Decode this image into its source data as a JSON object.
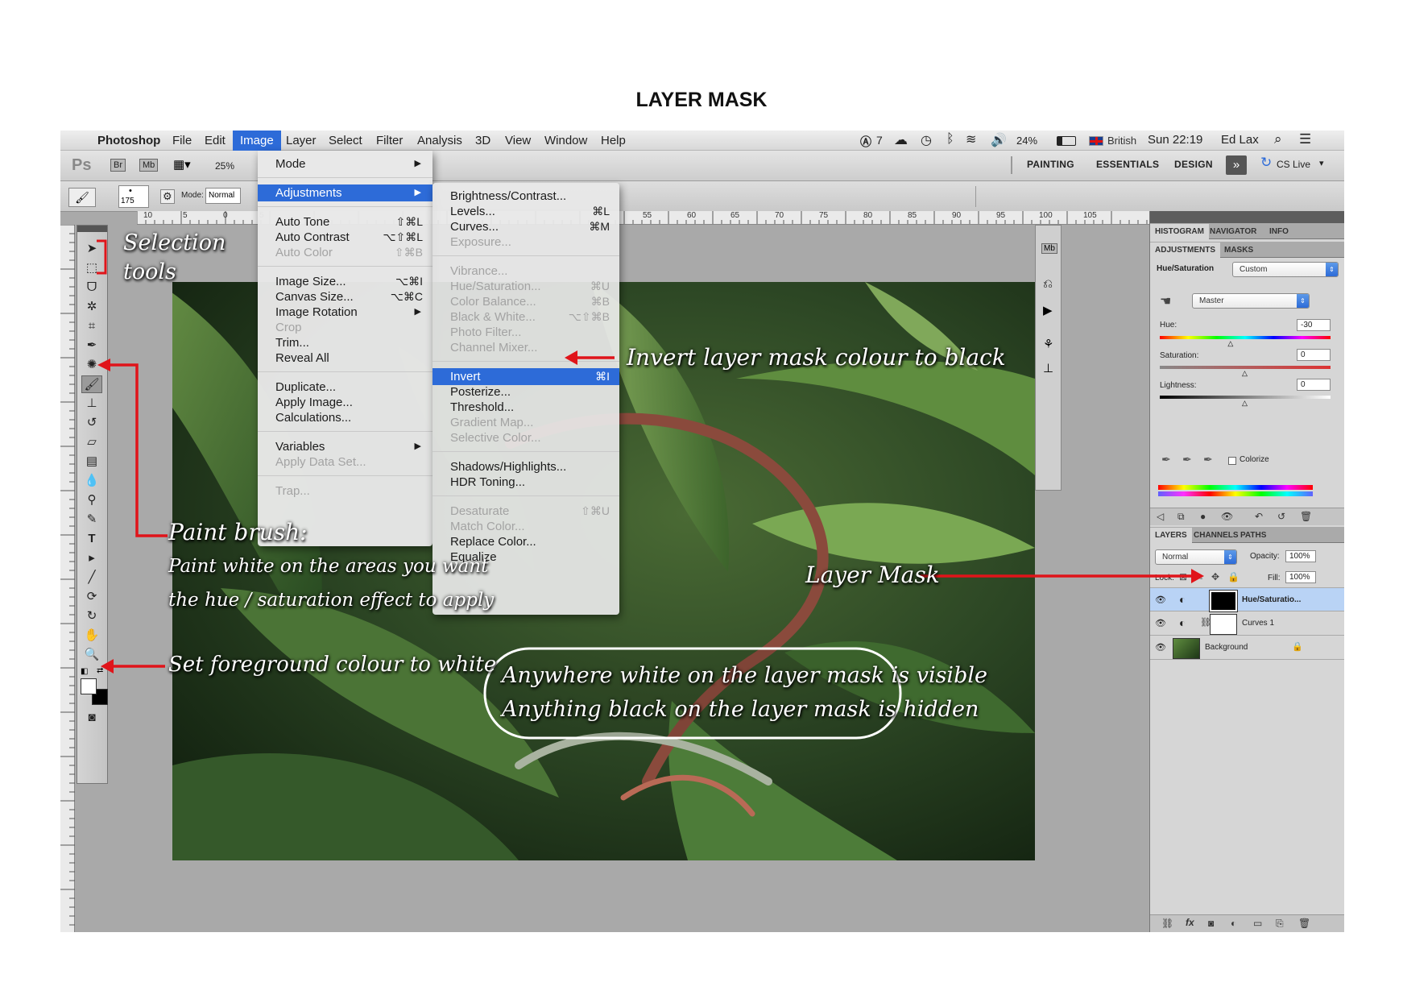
{
  "document_title": "LAYER MASK",
  "menubar": {
    "apple": "",
    "app": "Photoshop",
    "menus": [
      "File",
      "Edit",
      "Image",
      "Layer",
      "Select",
      "Filter",
      "Analysis",
      "3D",
      "View",
      "Window",
      "Help"
    ],
    "status": {
      "adobe_count": "7",
      "battery": "24%",
      "input_source": "British",
      "clock": "Sun 22:19",
      "user": "Ed Lax"
    }
  },
  "appbar": {
    "ps": "Ps",
    "br": "Br",
    "mb": "Mb",
    "zoom": "25%",
    "workspaces": [
      "PAINTING",
      "ESSENTIALS",
      "DESIGN"
    ],
    "cs_live": "CS Live"
  },
  "options": {
    "brush_size": "175",
    "mode_label": "Mode:",
    "mode_value": "Normal"
  },
  "ruler_ticks": [
    "10",
    "5",
    "0",
    "5",
    "55",
    "60",
    "65",
    "70",
    "75",
    "80",
    "85",
    "90",
    "95",
    "100",
    "105"
  ],
  "image_menu": {
    "items": [
      {
        "label": "Mode",
        "shortcut": "",
        "submenu": true,
        "disabled": false
      },
      {
        "sep": true
      },
      {
        "label": "Adjustments",
        "shortcut": "",
        "submenu": true,
        "highlight": true
      },
      {
        "sep": true
      },
      {
        "label": "Auto Tone",
        "shortcut": "⇧⌘L"
      },
      {
        "label": "Auto Contrast",
        "shortcut": "⌥⇧⌘L"
      },
      {
        "label": "Auto Color",
        "shortcut": "⇧⌘B",
        "disabled": true
      },
      {
        "sep": true
      },
      {
        "label": "Image Size...",
        "shortcut": "⌥⌘I"
      },
      {
        "label": "Canvas Size...",
        "shortcut": "⌥⌘C"
      },
      {
        "label": "Image Rotation",
        "shortcut": "",
        "submenu": true
      },
      {
        "label": "Crop",
        "shortcut": "",
        "disabled": true
      },
      {
        "label": "Trim...",
        "shortcut": ""
      },
      {
        "label": "Reveal All",
        "shortcut": ""
      },
      {
        "sep": true
      },
      {
        "label": "Duplicate...",
        "shortcut": ""
      },
      {
        "label": "Apply Image...",
        "shortcut": ""
      },
      {
        "label": "Calculations...",
        "shortcut": ""
      },
      {
        "sep": true
      },
      {
        "label": "Variables",
        "shortcut": "",
        "submenu": true
      },
      {
        "label": "Apply Data Set...",
        "shortcut": "",
        "disabled": true
      },
      {
        "sep": true
      },
      {
        "label": "Trap...",
        "shortcut": "",
        "disabled": true
      }
    ]
  },
  "adjustments_menu": {
    "items": [
      {
        "label": "Brightness/Contrast...",
        "shortcut": ""
      },
      {
        "label": "Levels...",
        "shortcut": "⌘L"
      },
      {
        "label": "Curves...",
        "shortcut": "⌘M"
      },
      {
        "label": "Exposure...",
        "shortcut": "",
        "disabled": true
      },
      {
        "sep": true
      },
      {
        "label": "Vibrance...",
        "shortcut": "",
        "disabled": true
      },
      {
        "label": "Hue/Saturation...",
        "shortcut": "⌘U",
        "disabled": true
      },
      {
        "label": "Color Balance...",
        "shortcut": "⌘B",
        "disabled": true
      },
      {
        "label": "Black & White...",
        "shortcut": "⌥⇧⌘B",
        "disabled": true
      },
      {
        "label": "Photo Filter...",
        "shortcut": "",
        "disabled": true
      },
      {
        "label": "Channel Mixer...",
        "shortcut": "",
        "disabled": true
      },
      {
        "sep": true
      },
      {
        "label": "Invert",
        "shortcut": "⌘I",
        "highlight": true
      },
      {
        "label": "Posterize...",
        "shortcut": ""
      },
      {
        "label": "Threshold...",
        "shortcut": ""
      },
      {
        "label": "Gradient Map...",
        "shortcut": "",
        "disabled": true
      },
      {
        "label": "Selective Color...",
        "shortcut": "",
        "disabled": true
      },
      {
        "sep": true
      },
      {
        "label": "Shadows/Highlights...",
        "shortcut": ""
      },
      {
        "label": "HDR Toning...",
        "shortcut": ""
      },
      {
        "sep": true
      },
      {
        "label": "Desaturate",
        "shortcut": "⇧⌘U",
        "disabled": true
      },
      {
        "label": "Match Color...",
        "shortcut": "",
        "disabled": true
      },
      {
        "label": "Replace Color...",
        "shortcut": ""
      },
      {
        "label": "Equalize",
        "shortcut": ""
      }
    ]
  },
  "panels": {
    "top_tabs": [
      "HISTOGRAM",
      "NAVIGATOR",
      "INFO"
    ],
    "adj_tabs": [
      "ADJUSTMENTS",
      "MASKS"
    ],
    "adj_title": "Hue/Saturation",
    "preset": "Custom",
    "channel": "Master",
    "hue_label": "Hue:",
    "hue": "-30",
    "sat_label": "Saturation:",
    "sat": "0",
    "light_label": "Lightness:",
    "light": "0",
    "colorize": "Colorize",
    "layer_tabs": [
      "LAYERS",
      "CHANNELS",
      "PATHS"
    ],
    "blend": "Normal",
    "opacity_label": "Opacity:",
    "opacity": "100%",
    "lock_label": "Lock:",
    "fill_label": "Fill:",
    "fill": "100%",
    "layers": [
      "Hue/Saturatio...",
      "Curves 1",
      "Background"
    ]
  },
  "annotations": {
    "selection": "Selection tools",
    "invert": "Invert layer mask colour to black",
    "paintbrush_title": "Paint brush:",
    "paintbrush_1": "Paint white on the areas you want",
    "paintbrush_2": "the hue / saturation effect to apply",
    "foreground": "Set foreground colour to white",
    "layer_mask": "Layer Mask",
    "callout_1": "Anywhere white on the layer mask is visible",
    "callout_2": "Anything black on the layer mask is hidden"
  },
  "colors": {
    "accent_blue": "#2d6bd8",
    "arrow_red": "#e0141a"
  }
}
